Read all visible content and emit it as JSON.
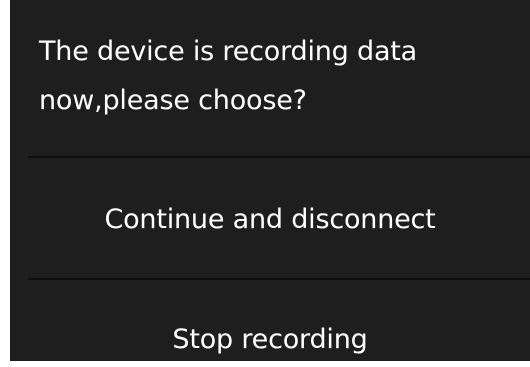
{
  "dialog": {
    "message_line1": "The device is recording data",
    "message_line2": "now,please choose?",
    "options": [
      {
        "label": "Continue and disconnect"
      },
      {
        "label": "Stop recording"
      }
    ]
  },
  "colors": {
    "dialog_background": "#1e1e1e",
    "divider": "#0e0e0e",
    "text": "#ffffff",
    "page_background": "#ffffff"
  }
}
